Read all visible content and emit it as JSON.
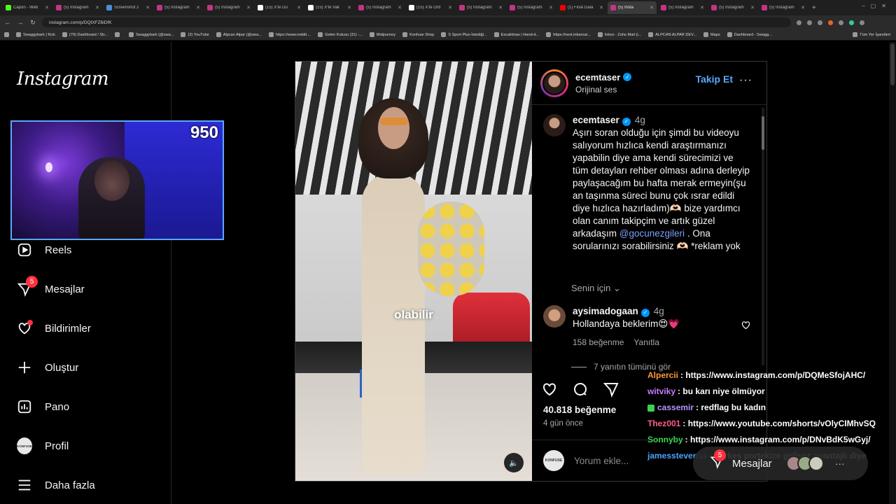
{
  "browser": {
    "tabs": [
      {
        "label": "Capon - Web",
        "icon": "kick-icon",
        "active": false
      },
      {
        "label": "(5) Instagram",
        "icon": "instagram-icon",
        "active": false
      },
      {
        "label": "Screenshot 2",
        "icon": "screenshot-icon",
        "active": false
      },
      {
        "label": "(5) Instagram",
        "icon": "instagram-icon",
        "active": false
      },
      {
        "label": "(5) Instagram",
        "icon": "instagram-icon",
        "active": false
      },
      {
        "label": "(15) X'te Dü",
        "icon": "x-icon",
        "active": false
      },
      {
        "label": "(15) X'te Vak",
        "icon": "x-icon",
        "active": false
      },
      {
        "label": "(5) Instagram",
        "icon": "instagram-icon",
        "active": false
      },
      {
        "label": "(15) X'te Ord",
        "icon": "x-icon",
        "active": false
      },
      {
        "label": "(5) Instagram",
        "icon": "instagram-icon",
        "active": false
      },
      {
        "label": "(5) Instagram",
        "icon": "instagram-icon",
        "active": false
      },
      {
        "label": "(1) Final Gala",
        "icon": "youtube-icon",
        "active": false
      },
      {
        "label": "(5) Insta",
        "icon": "instagram-icon",
        "active": true
      },
      {
        "label": "(5) Instagram",
        "icon": "instagram-icon",
        "active": false
      },
      {
        "label": "(5) Instagram",
        "icon": "instagram-icon",
        "active": false
      },
      {
        "label": "(5) Instagram",
        "icon": "instagram-icon",
        "active": false
      }
    ],
    "new_tab": "+",
    "url": "instagram.com/p/DQtXFZ6iDfK",
    "bookmarks": [
      "Swaggybark | Kick",
      "(79) Dashboard / Str...",
      "",
      "Swaggybark (@swa...",
      "(2) YouTube",
      "Alpcan Alpar (@swa...",
      "https://www.reddit....",
      "Gelen Kutusu (31) -...",
      "Midjourney",
      "Konfuse Shop",
      "S Sport Plus-İstediği...",
      "Excalidraw | Hand-d...",
      "https://next.inkarnat...",
      "Inbox - Zoho Mail (i...",
      "ALPCAN ALPAR DEV...",
      "Maps",
      "Dashboard - Swagg..."
    ],
    "bookmarks_all": "Tüm Yer İşaretleri"
  },
  "sidebar": {
    "logo": "Instagram",
    "items": [
      {
        "label": "Reels",
        "icon": "reels-icon"
      },
      {
        "label": "Mesajlar",
        "icon": "messages-icon",
        "badge": "5"
      },
      {
        "label": "Bildirimler",
        "icon": "heart-icon"
      },
      {
        "label": "Oluştur",
        "icon": "plus-icon"
      },
      {
        "label": "Pano",
        "icon": "dashboard-icon"
      },
      {
        "label": "Profil",
        "icon": "profile-avatar",
        "avatar_text": "KONFUSE"
      },
      {
        "label": "Daha fazla",
        "icon": "menu-icon"
      }
    ]
  },
  "webcam": {
    "counter": "950"
  },
  "post": {
    "username": "ecemtaser",
    "audio": "Orijinal ses",
    "follow": "Takip Et",
    "more": "···",
    "video_caption": "olabilir",
    "caption_comment": {
      "user": "ecemtaser",
      "time": "4g",
      "text": "Aşırı soran olduğu için şimdi bu videoyu salıyorum hızlıca kendi araştırmanızı yapabilin diye ama kendi sürecimizi ve tüm detayları rehber olması adına derleyip paylaşacağım bu hafta merak ermeyin(şu an taşınma süreci bunu çok ısrar edildi diye hızlıca hazırladım)🫶🏻 bize yardımcı olan canım takipçim ve artık güzel arkadaşım",
      "mention": "@gocunezgileri",
      "text_after": ". Ona sorularınızı sorabilirsiniz 🫶🏻 *reklam yok"
    },
    "see_translation": "Senin için",
    "comment": {
      "user": "aysimadogaan",
      "time": "4g",
      "text": "Hollandaya beklerim😍💗",
      "likes": "158 beğenme",
      "reply": "Yanıtla"
    },
    "view_replies": "7 yanıtın tümünü gör",
    "like_count": "40.818 beğenme",
    "date": "4 gün önce",
    "add_comment_placeholder": "Yorum ekle...",
    "commenter_avatar_text": "KONFUSE"
  },
  "chat": [
    {
      "user": "Alpercii",
      "text": ": https://www.instagram.com/p/DQMeSfojAHC/",
      "class": "u1"
    },
    {
      "user": "witviky",
      "text": ": bu karı niye ölmüyor",
      "class": "u2"
    },
    {
      "user": "cassemir",
      "text": ": redflag bu kadın",
      "class": "u3",
      "badge": true
    },
    {
      "user": "Thez001",
      "text": ": https://www.youtube.com/shorts/vOlyCIMhvSQ",
      "class": "u4"
    },
    {
      "user": "Sonnyby",
      "text": ": https://www.instagram.com/p/DNvBdK5wGyj/",
      "class": "u5"
    },
    {
      "user": "jamesstevenss",
      "text": ": herkes portekize gidiyor avantajlı diye",
      "class": "u6"
    }
  ],
  "messages_float": {
    "label": "Mesajlar",
    "badge": "5",
    "more": "···"
  }
}
